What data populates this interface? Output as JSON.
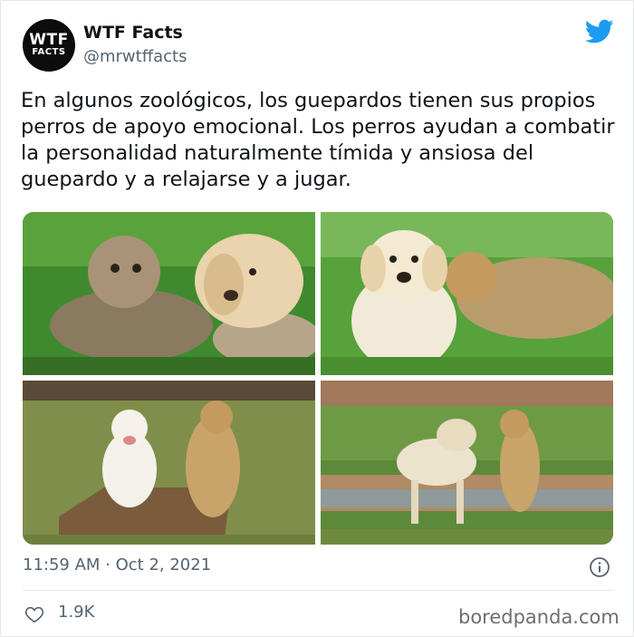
{
  "author": {
    "avatar_line1": "WTF",
    "avatar_line2": "FACTS",
    "name": "WTF Facts",
    "handle": "@mrwtffacts"
  },
  "tweet": {
    "text": "En algunos zoológicos, los guepardos tienen sus propios perros de apoyo emocional. Los perros ayudan a combatir la personalidad naturalmente tímida y ansiosa del guepardo y a relajarse y a jugar.",
    "timestamp": "11:59 AM · Oct 2, 2021",
    "likes": "1.9K"
  },
  "icons": {
    "brand": "twitter-bird-icon",
    "info": "info-icon",
    "like": "heart-icon"
  },
  "colors": {
    "twitter_blue": "#1d9bf0",
    "secondary_text": "#536471"
  },
  "watermark": "boredpanda.com"
}
